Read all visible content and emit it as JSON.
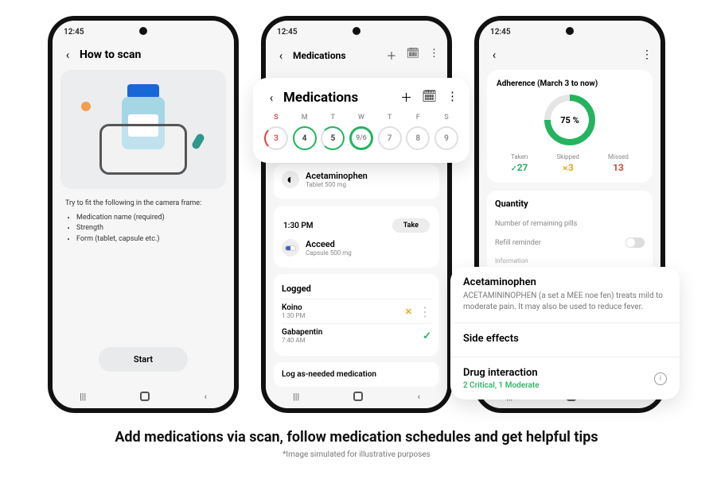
{
  "status_time": "12:45",
  "phone1": {
    "title": "How to scan",
    "intro": "Try to fit the following in the camera frame:",
    "bullets": [
      "Medication name (required)",
      "Strength",
      "Form (tablet, capsule etc.)"
    ],
    "start": "Start"
  },
  "phone2": {
    "title_small": "Medications",
    "overlay_title": "Medications",
    "weekdays": [
      "S",
      "M",
      "T",
      "W",
      "T",
      "F",
      "S"
    ],
    "days": [
      "3",
      "4",
      "5",
      "9/6",
      "7",
      "8",
      "9"
    ],
    "med_behind": {
      "name": "Acetaminophen",
      "sub": "Tablet 500 mg"
    },
    "time": "1:30 PM",
    "take": "Take",
    "med2": {
      "name": "Acceed",
      "sub": "Capsule 500 mg"
    },
    "logged_title": "Logged",
    "log1": {
      "name": "Koino",
      "time": "1:30 PM"
    },
    "log2": {
      "name": "Gabapentin",
      "time": "7:40 AM"
    },
    "log_as_needed": "Log as-needed medication"
  },
  "phone3": {
    "adh_title": "Adherence (March 3 to now)",
    "pct": "75 %",
    "taken_label": "Taken",
    "taken_val": "27",
    "skip_label": "Skipped",
    "skip_val": "3",
    "miss_label": "Missed",
    "miss_val": "13",
    "quantity": "Quantity",
    "remaining": "Number of remaining pills",
    "refill": "Refill reminder",
    "info_label": "Information",
    "drug_name": "Acetaminophen",
    "drug_desc": "ACETAMININOPHEN (a set a MEE noe fen) treats mild to moderate pain. It may also be used to reduce fever.",
    "side_effects": "Side effects",
    "interaction": "Drug interaction",
    "interaction_sub": "2 Critical, 1 Moderate"
  },
  "caption": "Add medications via scan, follow medication schedules and get helpful tips",
  "caption_sub": "*Image simulated for illustrative purposes",
  "chart_data": {
    "type": "pie",
    "title": "Adherence (March 3 to now)",
    "categories": [
      "Taken",
      "Skipped",
      "Missed"
    ],
    "values": [
      27,
      3,
      13
    ],
    "percent": 75
  }
}
